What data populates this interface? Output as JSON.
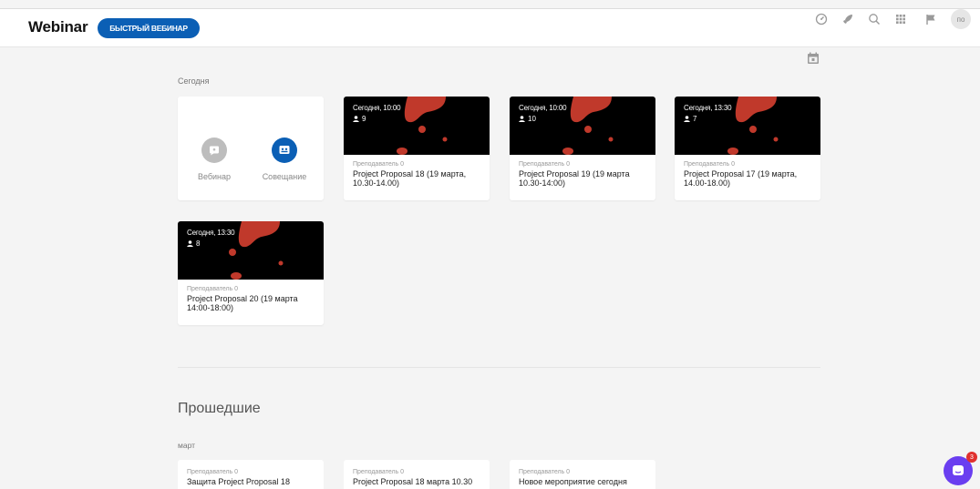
{
  "header": {
    "logo": "Webinar",
    "quick_button": "БЫСТРЫЙ ВЕБИНАР",
    "avatar_initials": "по",
    "icons": [
      "speedometer-icon",
      "rocket-icon",
      "search-icon",
      "apps-grid-icon",
      "flag-icon"
    ]
  },
  "today": {
    "title": "Сегодня",
    "create_options": [
      {
        "label": "Вебинар",
        "icon": "webinar-icon"
      },
      {
        "label": "Совещание",
        "icon": "meeting-icon"
      }
    ],
    "events": [
      {
        "time": "Сегодня, 10:00",
        "participants": "9",
        "teacher": "Преподаватель 0",
        "title": "Project Proposal 18 (19 марта, 10.30-14.00)"
      },
      {
        "time": "Сегодня, 10:00",
        "participants": "10",
        "teacher": "Преподаватель 0",
        "title": "Project Proposal 19 (19 марта 10.30-14:00)"
      },
      {
        "time": "Сегодня, 13:30",
        "participants": "7",
        "teacher": "Преподаватель 0",
        "title": "Project Proposal 17 (19 марта, 14.00-18.00)"
      },
      {
        "time": "Сегодня, 13:30",
        "participants": "8",
        "teacher": "Преподаватель 0",
        "title": "Project Proposal 20 (19 марта 14:00-18:00)"
      }
    ]
  },
  "past": {
    "title": "Прошедшие",
    "month": "март",
    "events": [
      {
        "teacher": "Преподаватель 0",
        "title": "Защита Project Proposal 18"
      },
      {
        "teacher": "Преподаватель 0",
        "title": "Project Proposal 18 марта 10.30"
      },
      {
        "teacher": "Преподаватель 0",
        "title": "Новое мероприятие сегодня"
      }
    ]
  },
  "chat": {
    "badge_count": "3"
  },
  "colors": {
    "accent": "#0b5fb5",
    "thumb_blob": "#c0392b",
    "chat": "#6a3ef0",
    "badge": "#e0302e"
  }
}
